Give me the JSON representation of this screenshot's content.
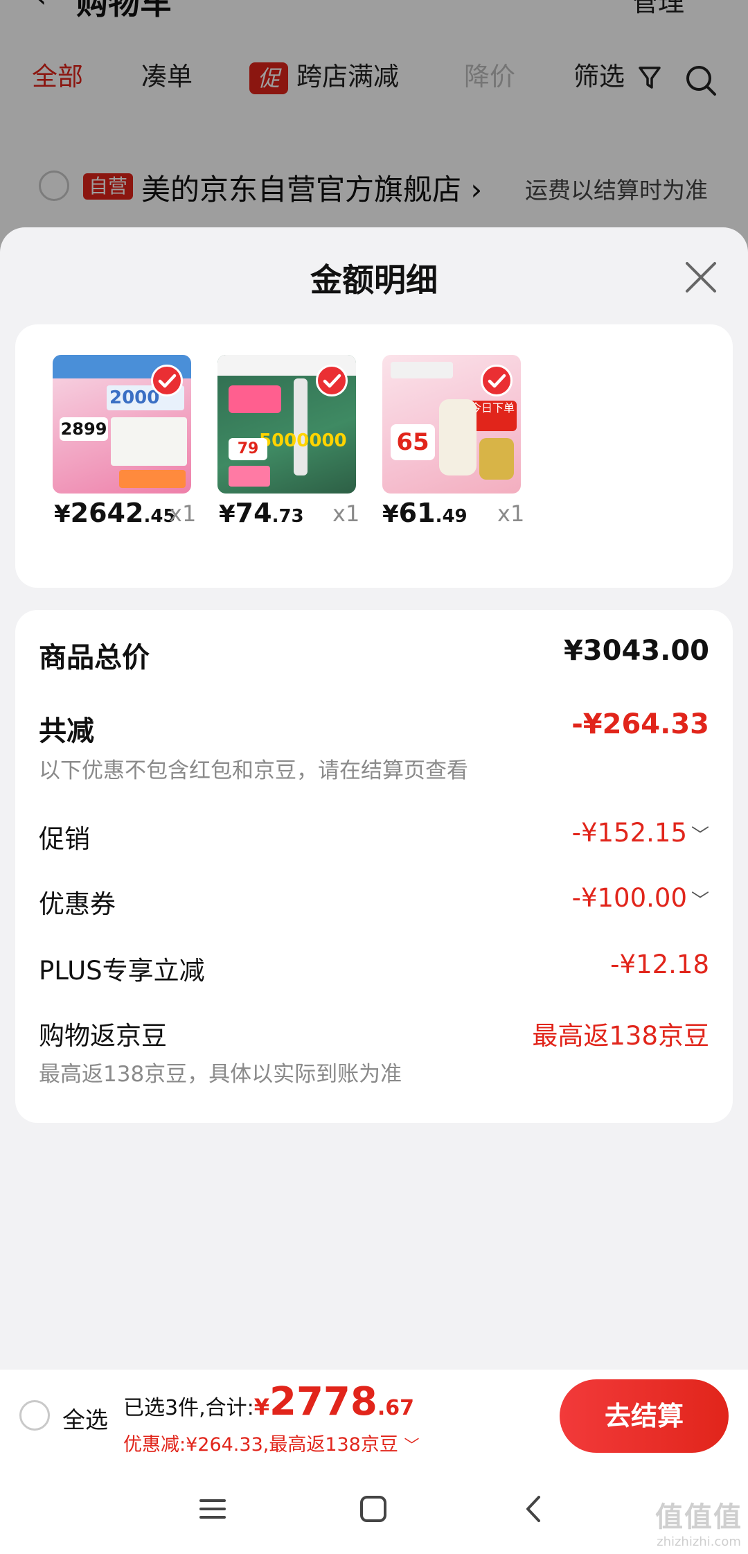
{
  "header": {
    "title": "购物车",
    "manage": "管理"
  },
  "tabs": [
    {
      "label": "全部"
    },
    {
      "label": "凑单"
    },
    {
      "badge": "促",
      "label": "跨店满减"
    },
    {
      "label": "降价"
    },
    {
      "label": "筛选"
    }
  ],
  "store": {
    "tag": "自营",
    "name": "美的京东自营官方旗舰店",
    "chevron": "›",
    "shipping_note": "运费以结算时为准"
  },
  "sheet": {
    "title": "金额明细",
    "products": [
      {
        "yen": "¥",
        "int": "2642",
        "dec": ".45",
        "qty": "x1",
        "thumb_text": "2000",
        "thumb_price": "2899",
        "icon": "air-conditioner-product-image"
      },
      {
        "yen": "¥",
        "int": "74",
        "dec": ".73",
        "qty": "x1",
        "thumb_text": "5000000",
        "thumb_price": "79",
        "icon": "garment-steamer-product-image"
      },
      {
        "yen": "¥",
        "int": "61",
        "dec": ".49",
        "qty": "x1",
        "thumb_text": "今日下单",
        "thumb_price": "65",
        "icon": "electric-kettle-product-image"
      }
    ],
    "total_label": "商品总价",
    "total_value": "¥3043.00",
    "reduce_label": "共减",
    "reduce_value": "-¥264.33",
    "reduce_note": "以下优惠不包含红包和京豆，请在结算页查看",
    "promo_label": "促销",
    "promo_value": "-¥152.15",
    "coupon_label": "优惠券",
    "coupon_value": "-¥100.00",
    "plus_label": "PLUS专享立减",
    "plus_value": "-¥12.18",
    "beans_label": "购物返京豆",
    "beans_value": "最高返138京豆",
    "beans_note": "最高返138京豆，具体以实际到账为准"
  },
  "checkout": {
    "select_all": "全选",
    "summary_label": "已选3件,合计:",
    "currency": "¥",
    "amount_int": "2778",
    "amount_dec": ".67",
    "discount_line": "优惠减:¥264.33,最高返138京豆",
    "button": "去结算"
  },
  "watermark": {
    "main": "值值值",
    "sub": "zhizhizhi.com"
  },
  "colors": {
    "accent": "#e1251b",
    "text": "#111111",
    "muted": "#8a8a8a",
    "sheet_bg": "#f2f2f4"
  }
}
